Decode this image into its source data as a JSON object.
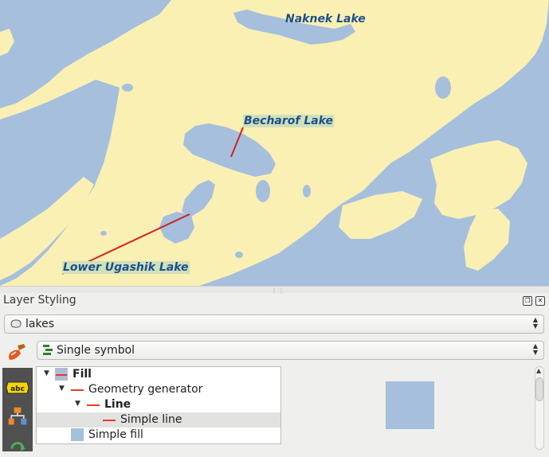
{
  "map": {
    "labels": {
      "naknek": "Naknek Lake",
      "becharof": "Becharof Lake",
      "ugashik": "Lower Ugashik Lake"
    },
    "colors": {
      "land": "#faf0b4",
      "water": "#a5bfdd",
      "label": "#1d4f8e",
      "label_bg": "#cfe1b9",
      "callout": "#d42020"
    }
  },
  "panel": {
    "title": "Layer Styling",
    "layer_combo_value": "lakes",
    "renderer_combo_value": "Single symbol",
    "tree": [
      {
        "label": "Fill",
        "symbol": "fill-line"
      },
      {
        "label": "Geometry generator",
        "symbol": "line"
      },
      {
        "label": "Line",
        "symbol": "line"
      },
      {
        "label": "Simple line",
        "symbol": "line",
        "selected": true
      },
      {
        "label": "Simple fill",
        "symbol": "fill"
      }
    ],
    "icons": [
      "polygon-layer-icon",
      "paint-brush-icon",
      "labels-abc-icon",
      "diagram-icon",
      "history-icon"
    ]
  }
}
